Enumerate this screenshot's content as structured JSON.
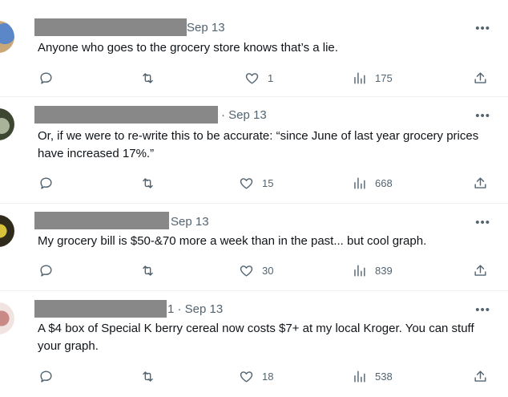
{
  "colors": {
    "text": "#0f1419",
    "muted": "#536471",
    "divider": "#eff3f4",
    "redaction": "#888888"
  },
  "icons": {
    "reply": "reply-icon",
    "retweet": "retweet-icon",
    "like": "heart-icon",
    "views": "views-icon",
    "share": "share-icon",
    "more": "more-dots-icon"
  },
  "more_label": "•••",
  "tweets": [
    {
      "date": "Sep 13",
      "text": "Anyone who goes to the grocery store knows that’s a lie.",
      "likes": "1",
      "views": "175"
    },
    {
      "date": "· Sep 13",
      "text": "Or, if we were to re-write this to be accurate: “since June of last year grocery prices have increased 17%.”",
      "likes": "15",
      "views": "668"
    },
    {
      "date": "Sep 13",
      "text": "My grocery bill is $50-&70 more a week than in the past...  but cool graph.",
      "likes": "30",
      "views": "839"
    },
    {
      "date": "1 · Sep 13",
      "text": "A $4 box of Special K berry cereal now costs $7+ at my local Kroger. You can stuff your graph.",
      "likes": "18",
      "views": "538"
    }
  ]
}
